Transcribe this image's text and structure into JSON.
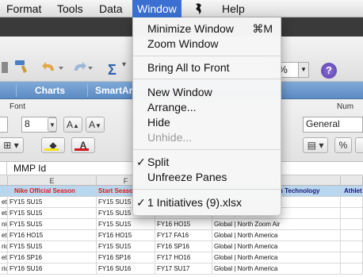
{
  "menubar": {
    "items": [
      {
        "label": "Format"
      },
      {
        "label": "Tools"
      },
      {
        "label": "Data"
      },
      {
        "label": "Window"
      },
      {
        "label": "Help"
      }
    ],
    "script_icon": "script-icon"
  },
  "window_menu": {
    "items": [
      {
        "label": "Minimize Window",
        "shortcut": "⌘M"
      },
      {
        "label": "Zoom Window"
      },
      {
        "label": "Bring All to Front"
      },
      {
        "label": "New Window"
      },
      {
        "label": "Arrange..."
      },
      {
        "label": "Hide"
      },
      {
        "label": "Unhide..."
      },
      {
        "label": "Split",
        "checked": true
      },
      {
        "label": "Unfreeze Panes"
      },
      {
        "label": "1 Initiatives (9).xlsx",
        "checked": true
      }
    ],
    "check_glyph": "✓"
  },
  "toolbar": {
    "zoom_value": "0%",
    "help_label": "?",
    "sigma_label": "Σ"
  },
  "ribbon_tabs": [
    "Charts",
    "SmartArt"
  ],
  "ribbon": {
    "font_label": "Font",
    "number_label": "Num",
    "font_size": "8",
    "number_format": "General",
    "grow_font": "A",
    "shrink_font": "A",
    "font_color_label": "A",
    "percent_label": "%"
  },
  "formula_bar": {
    "value": "MMP Id"
  },
  "grid": {
    "col_headers": [
      "E",
      "F",
      "I"
    ],
    "header_row": [
      "Nike Official Season",
      "Start Season",
      "n Technology",
      "Athlet"
    ],
    "row_prefixes": [
      "etbal",
      "etbal",
      "ning",
      "etbal",
      "rican",
      "etbal",
      "rican",
      "rican"
    ],
    "col_e": [
      "FY15 SU15",
      "FY15 SU15",
      "FY15 SU15",
      "FY16 HO15",
      "FY15 SU15",
      "FY16 SP16",
      "FY16 SU16"
    ],
    "col_f": [
      "FY15 SU15",
      "FY15 SU15",
      "FY15 SU15",
      "FY16 HO15",
      "FY15 SU15",
      "FY16 SP16",
      "FY16 SU16"
    ],
    "col_g": [
      "FY15 SU15",
      "FY15 SU15",
      "FY16 HO15",
      "FY17 FA16",
      "FY16 SP16",
      "FY17 HO16",
      "FY17 SU17"
    ],
    "col_i": [
      "Global",
      "Global | North America",
      "Global | North Zoom Air",
      "Global | North America",
      "Global | North America",
      "Global | North America",
      "Global | North America"
    ]
  },
  "colors": {
    "menu_highlight": "#3b6fd1",
    "ribbon_tab_blue": "#5c8bc4",
    "header_row_blue": "#b8d6ee",
    "header_text_red": "#e01a1a"
  }
}
